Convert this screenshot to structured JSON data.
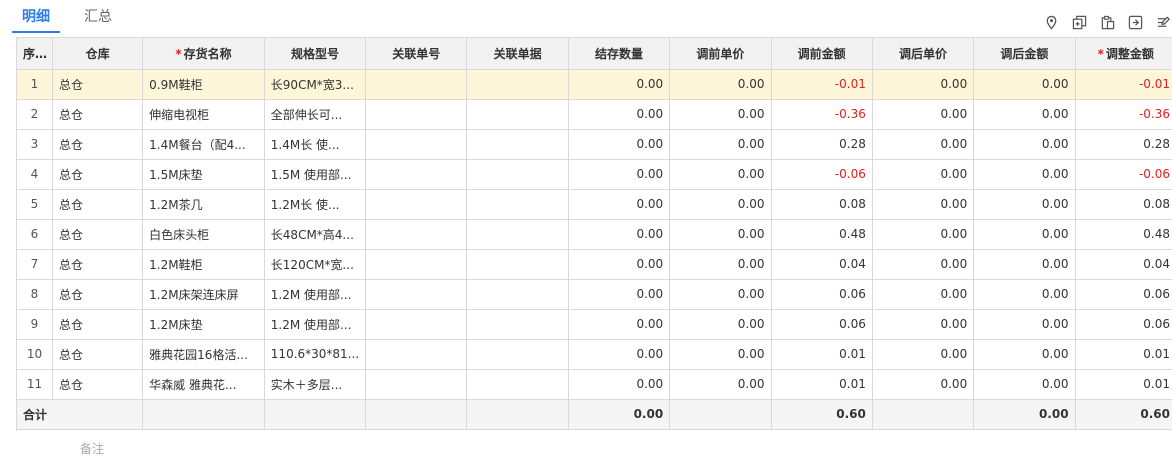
{
  "tabs": {
    "detail": "明细",
    "summary": "汇总"
  },
  "toolbar": {
    "icons": [
      "location-icon",
      "copy-add-icon",
      "paste-icon",
      "export-icon",
      "settings-icon"
    ]
  },
  "table": {
    "headers": [
      "序号",
      "仓库",
      "存货名称",
      "规格型号",
      "关联单号",
      "关联单据",
      "结存数量",
      "调前单价",
      "调前金额",
      "调后单价",
      "调后金额",
      "调整金额"
    ],
    "required_marker": "*",
    "rows": [
      [
        "1",
        "总仓",
        "0.9M鞋柜",
        "长90CM*宽3...",
        "",
        "",
        "0.00",
        "0.00",
        "-0.01",
        "0.00",
        "0.00",
        "-0.01"
      ],
      [
        "2",
        "总仓",
        "伸缩电视柜",
        "全部伸长可...",
        "",
        "",
        "0.00",
        "0.00",
        "-0.36",
        "0.00",
        "0.00",
        "-0.36"
      ],
      [
        "3",
        "总仓",
        "1.4M餐台（配4...",
        "1.4M长 使...",
        "",
        "",
        "0.00",
        "0.00",
        "0.28",
        "0.00",
        "0.00",
        "0.28"
      ],
      [
        "4",
        "总仓",
        "1.5M床垫",
        "1.5M 使用部...",
        "",
        "",
        "0.00",
        "0.00",
        "-0.06",
        "0.00",
        "0.00",
        "-0.06"
      ],
      [
        "5",
        "总仓",
        "1.2M茶几",
        "1.2M长 使...",
        "",
        "",
        "0.00",
        "0.00",
        "0.08",
        "0.00",
        "0.00",
        "0.08"
      ],
      [
        "6",
        "总仓",
        "白色床头柜",
        "长48CM*高4...",
        "",
        "",
        "0.00",
        "0.00",
        "0.48",
        "0.00",
        "0.00",
        "0.48"
      ],
      [
        "7",
        "总仓",
        "1.2M鞋柜",
        "长120CM*宽...",
        "",
        "",
        "0.00",
        "0.00",
        "0.04",
        "0.00",
        "0.00",
        "0.04"
      ],
      [
        "8",
        "总仓",
        "1.2M床架连床屏",
        "1.2M 使用部...",
        "",
        "",
        "0.00",
        "0.00",
        "0.06",
        "0.00",
        "0.00",
        "0.06"
      ],
      [
        "9",
        "总仓",
        "1.2M床垫",
        "1.2M 使用部...",
        "",
        "",
        "0.00",
        "0.00",
        "0.06",
        "0.00",
        "0.00",
        "0.06"
      ],
      [
        "10",
        "总仓",
        "雅典花园16格活...",
        "110.6*30*81...",
        "",
        "",
        "0.00",
        "0.00",
        "0.01",
        "0.00",
        "0.00",
        "0.01"
      ],
      [
        "11",
        "总仓",
        "华森威 雅典花...",
        "实木＋多层...",
        "",
        "",
        "0.00",
        "0.00",
        "0.01",
        "0.00",
        "0.00",
        "0.01"
      ]
    ],
    "total": {
      "label": "合计",
      "quantity": "0.00",
      "before_amount": "0.60",
      "after_amount": "0.00",
      "adjust_amount": "0.60"
    }
  },
  "bottom_note": "备注",
  "colors": {
    "accent": "#2b7de9",
    "negative": "#e02020",
    "selected_row": "#fdf6d8"
  }
}
